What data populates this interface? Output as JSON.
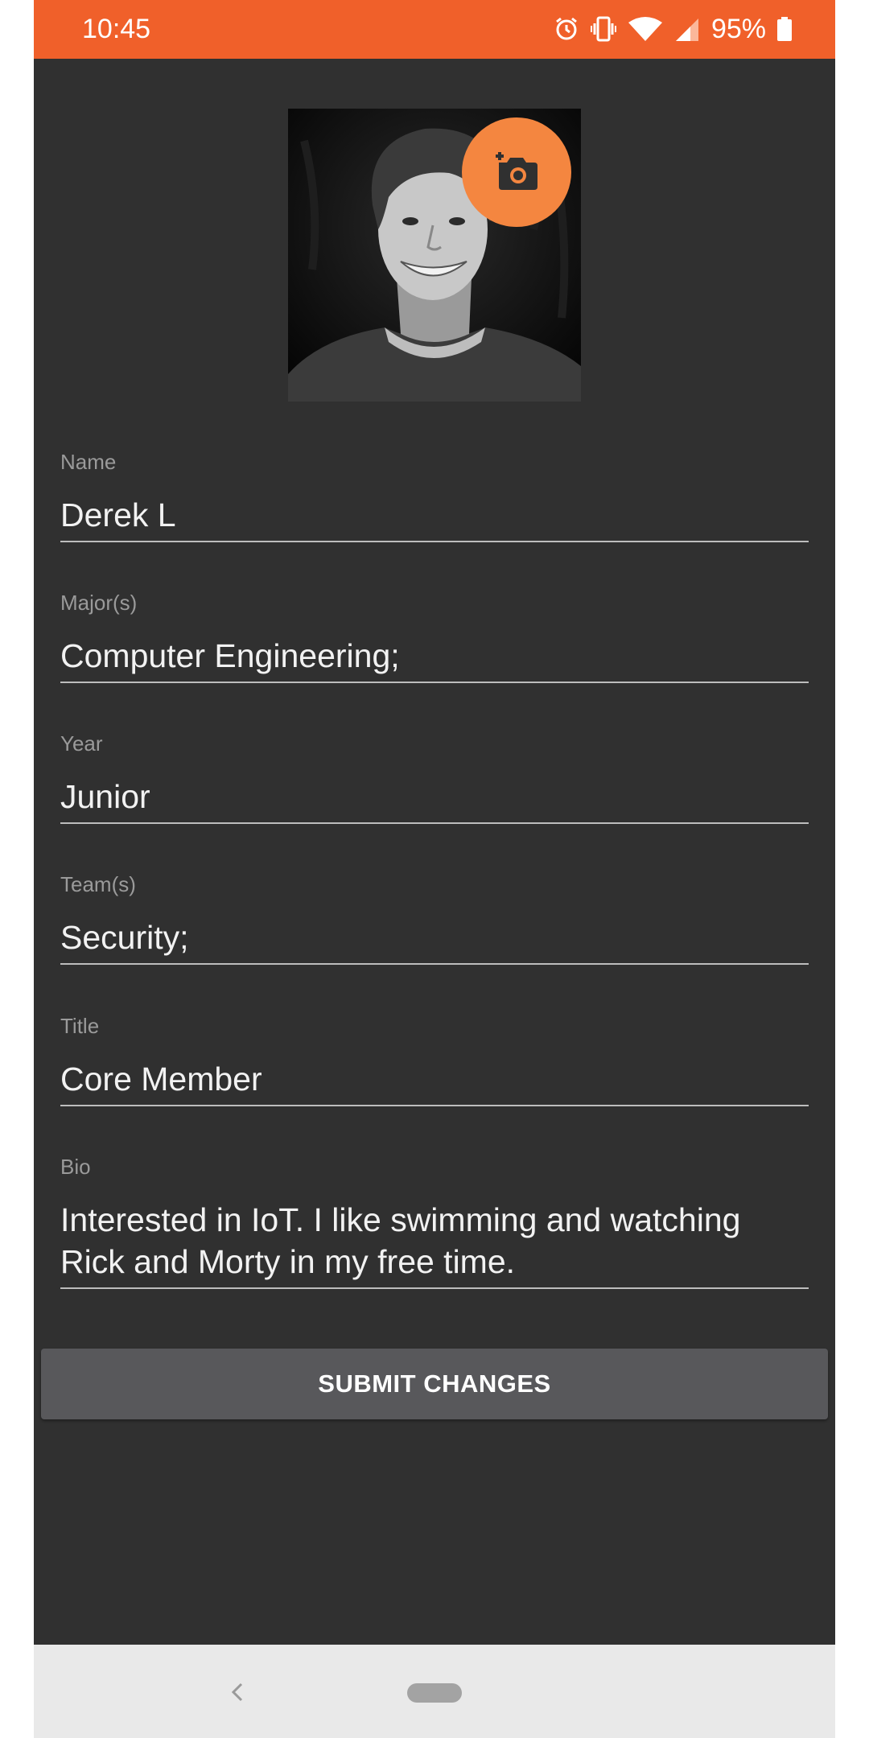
{
  "status_bar": {
    "time": "10:45",
    "battery": "95%",
    "icons": [
      "alarm-icon",
      "vibrate-icon",
      "wifi-icon",
      "signal-icon",
      "battery-icon"
    ],
    "color": "#f0602a"
  },
  "profile": {
    "photo_icon": "camera-add-icon",
    "accent": "#f48640"
  },
  "form": {
    "name": {
      "label": "Name",
      "value": "Derek L"
    },
    "majors": {
      "label": "Major(s)",
      "value": "Computer Engineering;"
    },
    "year": {
      "label": "Year",
      "value": "Junior"
    },
    "teams": {
      "label": "Team(s)",
      "value": "Security;"
    },
    "title": {
      "label": "Title",
      "value": "Core Member"
    },
    "bio": {
      "label": "Bio",
      "line1": "Interested in IoT. I like swimming and watching",
      "line2": "Rick and Morty in my free time."
    }
  },
  "submit": {
    "label": "SUBMIT CHANGES"
  },
  "nav": {
    "icons": [
      "back-icon",
      "home-pill"
    ]
  }
}
